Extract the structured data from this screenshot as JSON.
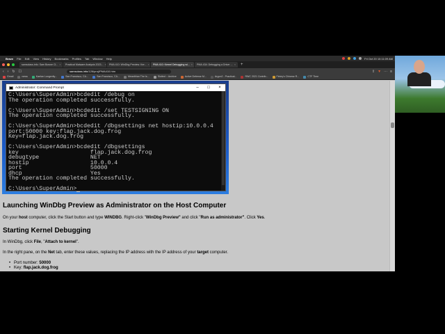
{
  "menubar": {
    "app": "Brave",
    "items": [
      "File",
      "Edit",
      "View",
      "History",
      "Bookmarks",
      "Profiles",
      "Tab",
      "Window",
      "Help"
    ],
    "datetime": "Fri Oct 20 10:11:09 AM"
  },
  "tabs": [
    {
      "label": "samsclass.info: Sam Bowne Cl...",
      "active": false
    },
    {
      "label": "Practical Malware Analysis 2023...",
      "active": false
    },
    {
      "label": "PMA 410: WinDbg Preview: Ker...",
      "active": false
    },
    {
      "label": "PMA 410: Kernel Debugging wi...",
      "active": true
    },
    {
      "label": "PMA 434: Debugging a Driver ...",
      "active": false
    }
  ],
  "address": {
    "domain": "samsclass.info",
    "path": "/126/proj/PMA410.htm"
  },
  "bookmarks": [
    "Gmail",
    "news",
    "Kaelan Longevity...",
    "San Francisco, CA...",
    "San Francisco, CA...",
    "Meanthian The Is...",
    "Slotted :: Archive",
    "Active Defense M...",
    "Argon2 - Practical...",
    "RWC 2021 Contrib...",
    "Finley's Chinese R...",
    "CTF Time"
  ],
  "cmd": {
    "title": "Administrator: Command Prompt",
    "lines": [
      "C:\\Users\\SuperAdmin>bcdedit /debug on",
      "The operation completed successfully.",
      "",
      "C:\\Users\\SuperAdmin>bcdedit /set TESTSIGNING ON",
      "The operation completed successfully.",
      "",
      "C:\\Users\\SuperAdmin>bcdedit /dbgsettings net hostip:10.0.0.4",
      "port:50000 key:flap.jack.dog.frog",
      "Key=flap.jack.dog.frog",
      "",
      "C:\\Users\\SuperAdmin>bcdedit /dbgsettings",
      "key                     flap.jack.dog.frog",
      "debugtype               NET",
      "hostip                  10.0.0.4",
      "port                    50000",
      "dhcp                    Yes",
      "The operation completed successfully.",
      "",
      "C:\\Users\\SuperAdmin>"
    ]
  },
  "article": {
    "h_launch": "Launching WinDbg Preview as Administrator on the Host Computer",
    "p1_a": "On your ",
    "p1_b": "host",
    "p1_c": " computer, click the Start button and type ",
    "p1_d": "WINDBG",
    "p1_e": ". Right-click \"",
    "p1_f": "WinDbg Preview\"",
    "p1_g": " and click \"",
    "p1_h": "Run as administrator\"",
    "p1_i": ". Click ",
    "p1_j": "Yes",
    "p1_k": ".",
    "h_start": "Starting Kernel Debugging",
    "p2_a": "In WinDbg, click ",
    "p2_b": "File",
    "p2_c": ", \"",
    "p2_d": "Attach to kernel",
    "p2_e": "\".",
    "p3_a": "In the right pane, on the ",
    "p3_b": "Net",
    "p3_c": " tab, enter these values, replacing the IP address with the IP address of your ",
    "p3_d": "target",
    "p3_e": " computer.",
    "li1_a": "Port number: ",
    "li1_b": "50000",
    "li2_a": "Key: ",
    "li2_b": "flap.jack.dog.frog"
  }
}
